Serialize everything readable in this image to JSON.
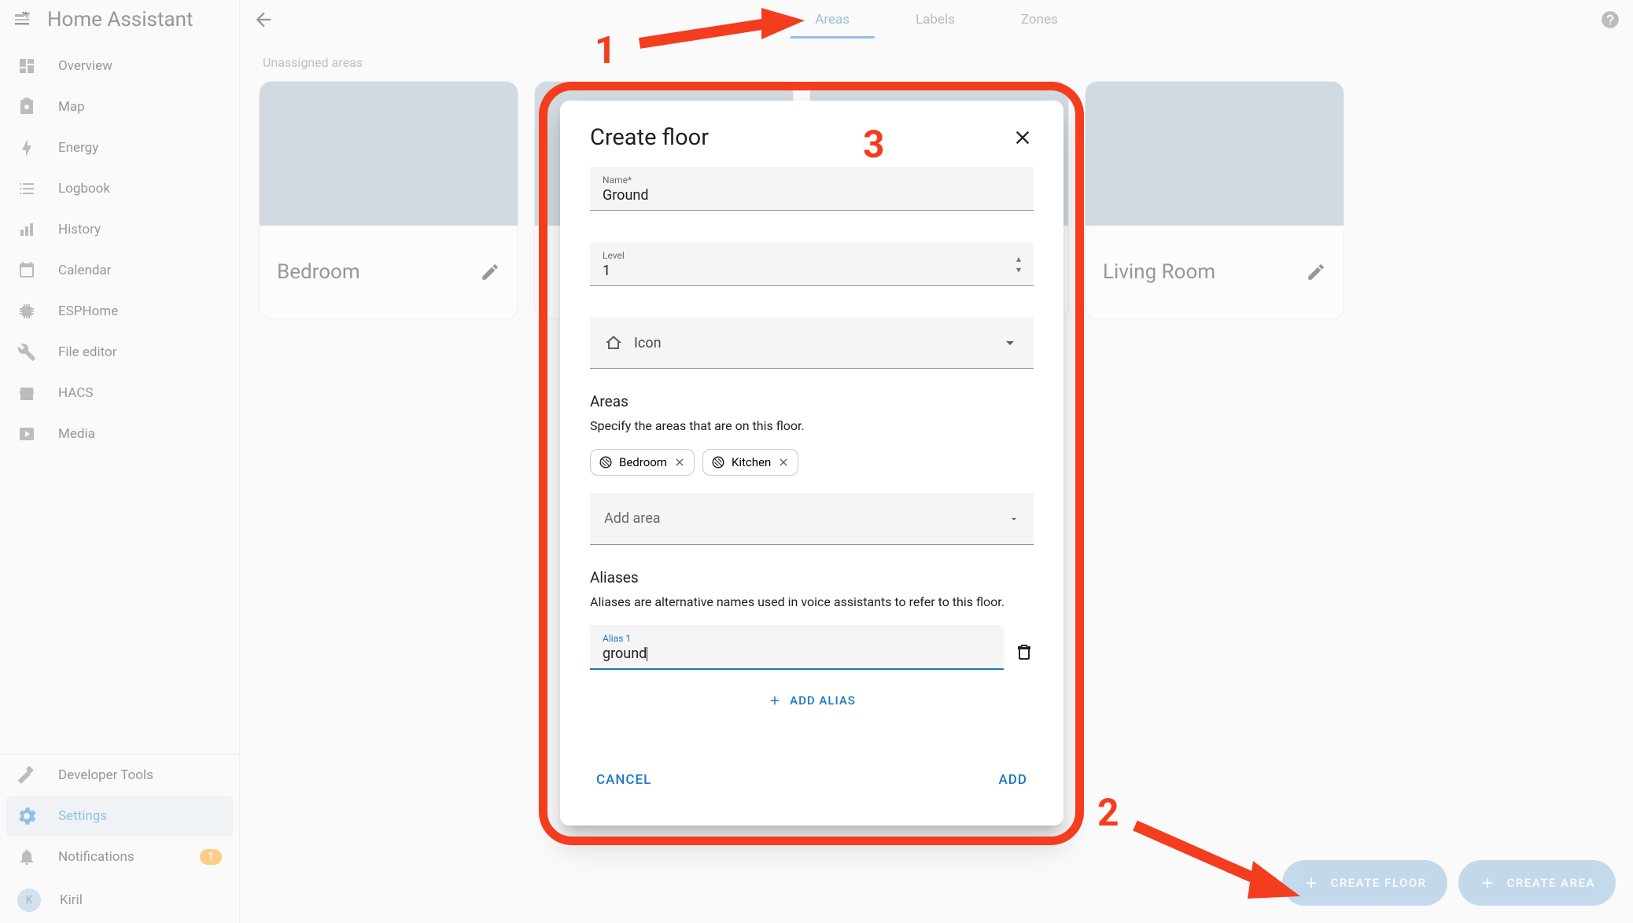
{
  "app": {
    "title": "Home Assistant"
  },
  "sidebar": {
    "items": [
      {
        "label": "Overview"
      },
      {
        "label": "Map"
      },
      {
        "label": "Energy"
      },
      {
        "label": "Logbook"
      },
      {
        "label": "History"
      },
      {
        "label": "Calendar"
      },
      {
        "label": "ESPHome"
      },
      {
        "label": "File editor"
      },
      {
        "label": "HACS"
      },
      {
        "label": "Media"
      }
    ],
    "bottom": {
      "developer": "Developer Tools",
      "settings": "Settings",
      "notifications": "Notifications",
      "notification_count": "1",
      "user_initial": "K",
      "user_name": "Kiril"
    }
  },
  "tabs": {
    "areas": "Areas",
    "labels": "Labels",
    "zones": "Zones"
  },
  "content": {
    "section_label": "Unassigned areas",
    "cards": [
      {
        "title": "Bedroom"
      },
      {
        "title": ""
      },
      {
        "title": ""
      },
      {
        "title": "Living Room"
      }
    ]
  },
  "fabs": {
    "create_floor": "CREATE FLOOR",
    "create_area": "CREATE AREA"
  },
  "dialog": {
    "title": "Create floor",
    "name_label": "Name*",
    "name_value": "Ground",
    "level_label": "Level",
    "level_value": "1",
    "icon_label": "Icon",
    "areas_title": "Areas",
    "areas_desc": "Specify the areas that are on this floor.",
    "chips": [
      {
        "label": "Bedroom"
      },
      {
        "label": "Kitchen"
      }
    ],
    "add_area_placeholder": "Add area",
    "aliases_title": "Aliases",
    "aliases_desc": "Aliases are alternative names used in voice assistants to refer to this floor.",
    "alias_label": "Alias 1",
    "alias_value": "ground",
    "add_alias_btn": "ADD ALIAS",
    "cancel_btn": "CANCEL",
    "add_btn": "ADD"
  },
  "annotations": {
    "n1": "1",
    "n2": "2",
    "n3": "3"
  }
}
